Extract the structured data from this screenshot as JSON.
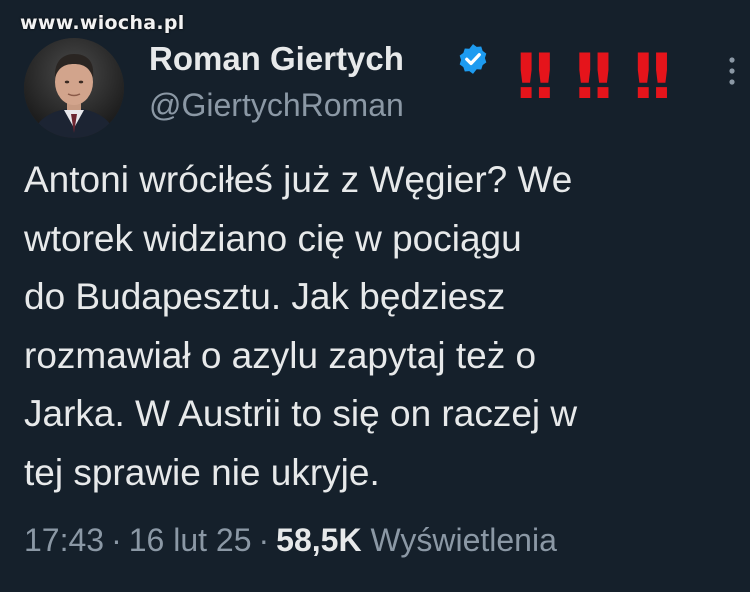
{
  "watermark": {
    "text": "www.wiocha.pl"
  },
  "author": {
    "display_name": "Roman Giertych",
    "handle": "@GiertychRoman",
    "verified": true
  },
  "exclamations": [
    "!!",
    "!!",
    "!!"
  ],
  "tweet": {
    "lines": [
      "Antoni wróciłeś już z Węgier? We",
      "wtorek widziano cię w pociągu",
      "do Budapesztu. Jak będziesz",
      "rozmawiał o azylu zapytaj też o",
      "Jarka. W Austrii to się on raczej w",
      "tej sprawie nie ukryje."
    ]
  },
  "meta": {
    "time": "17:43",
    "date": "16 lut 25",
    "separator": "·",
    "views": "58,5K",
    "views_label": "Wyświetlenia"
  },
  "colors": {
    "background": "#15202b",
    "text": "#e7e9ea",
    "secondary": "#8b98a5",
    "verified": "#1d9bf0",
    "exclamation": "#e5141b"
  },
  "icons": {
    "verified": "verified-badge-icon",
    "more": "more-options-icon"
  }
}
